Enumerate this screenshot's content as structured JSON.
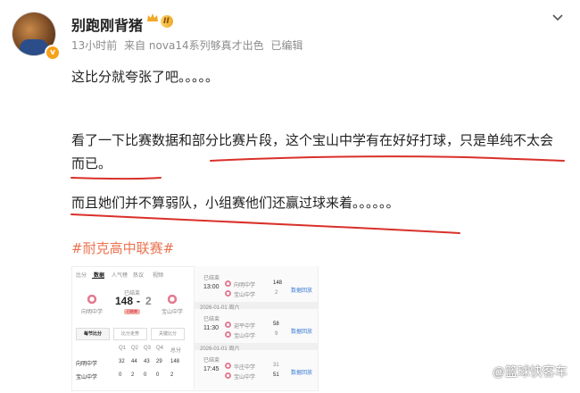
{
  "author": {
    "name": "别跑刚背猪",
    "level_badge": "II",
    "verified": true,
    "verified_mark": "v"
  },
  "meta": {
    "time": "13小时前",
    "source": "来自 nova14系列够真才出色",
    "edited": "已编辑"
  },
  "post": {
    "line1": "这比分就夸张了吧。。。。。",
    "line2a": "看了一下比赛数据和部分比赛片段，这个宝山中学有在好好打球，只是单纯不太会",
    "line2b": "而已。",
    "line3": "而且她们并不算弱队，小组赛他们还赢过球来着。。。。。。",
    "hashtag": "#耐克高中联赛#"
  },
  "colors": {
    "hashtag": "#eb7350",
    "underline": "#d9302a",
    "badge": "#f0a927"
  },
  "screenshot1": {
    "tabs": [
      "比分",
      "数据",
      "人气榜",
      "热议",
      "视频"
    ],
    "active_tab": "数据",
    "home_team": "向明中学",
    "away_team": "宝山中学",
    "score_home": "148",
    "score_sep": "-",
    "score_away": "2",
    "status_top": "已结束",
    "status_pill": "已结束",
    "segments": [
      "每节比分",
      "比分走势",
      "关键比分"
    ],
    "table_header": [
      "",
      "Q1",
      "Q2",
      "Q3",
      "Q4",
      "总分"
    ],
    "rows": [
      {
        "team": "向明中学",
        "q": [
          "32",
          "44",
          "43",
          "29",
          "148"
        ]
      },
      {
        "team": "宝山中学",
        "q": [
          "0",
          "2",
          "0",
          "0",
          "2"
        ]
      }
    ]
  },
  "screenshot2": {
    "games": [
      {
        "label": "已结束",
        "time": "13:00",
        "home": "向明中学",
        "away": "宝山中学",
        "hs": "148",
        "as": "2",
        "link": "数据回放"
      },
      {
        "date": "2026-01-01 周六",
        "label": "已结束",
        "time": "11:30",
        "home": "迎平中学",
        "away": "宝山中学",
        "hs": "58",
        "as": "9",
        "link": "数据回放"
      },
      {
        "date": "2026-01-01 周六",
        "label": "已结束",
        "time": "17:45",
        "home": "华庄中学",
        "away": "宝山中学",
        "hs": "31",
        "as": "51",
        "link": "数据回放"
      }
    ]
  },
  "watermark": "@篮球快客车",
  "icons": [
    "chevron-down-icon",
    "crown-icon",
    "verified-icon",
    "team-logo-icon"
  ]
}
